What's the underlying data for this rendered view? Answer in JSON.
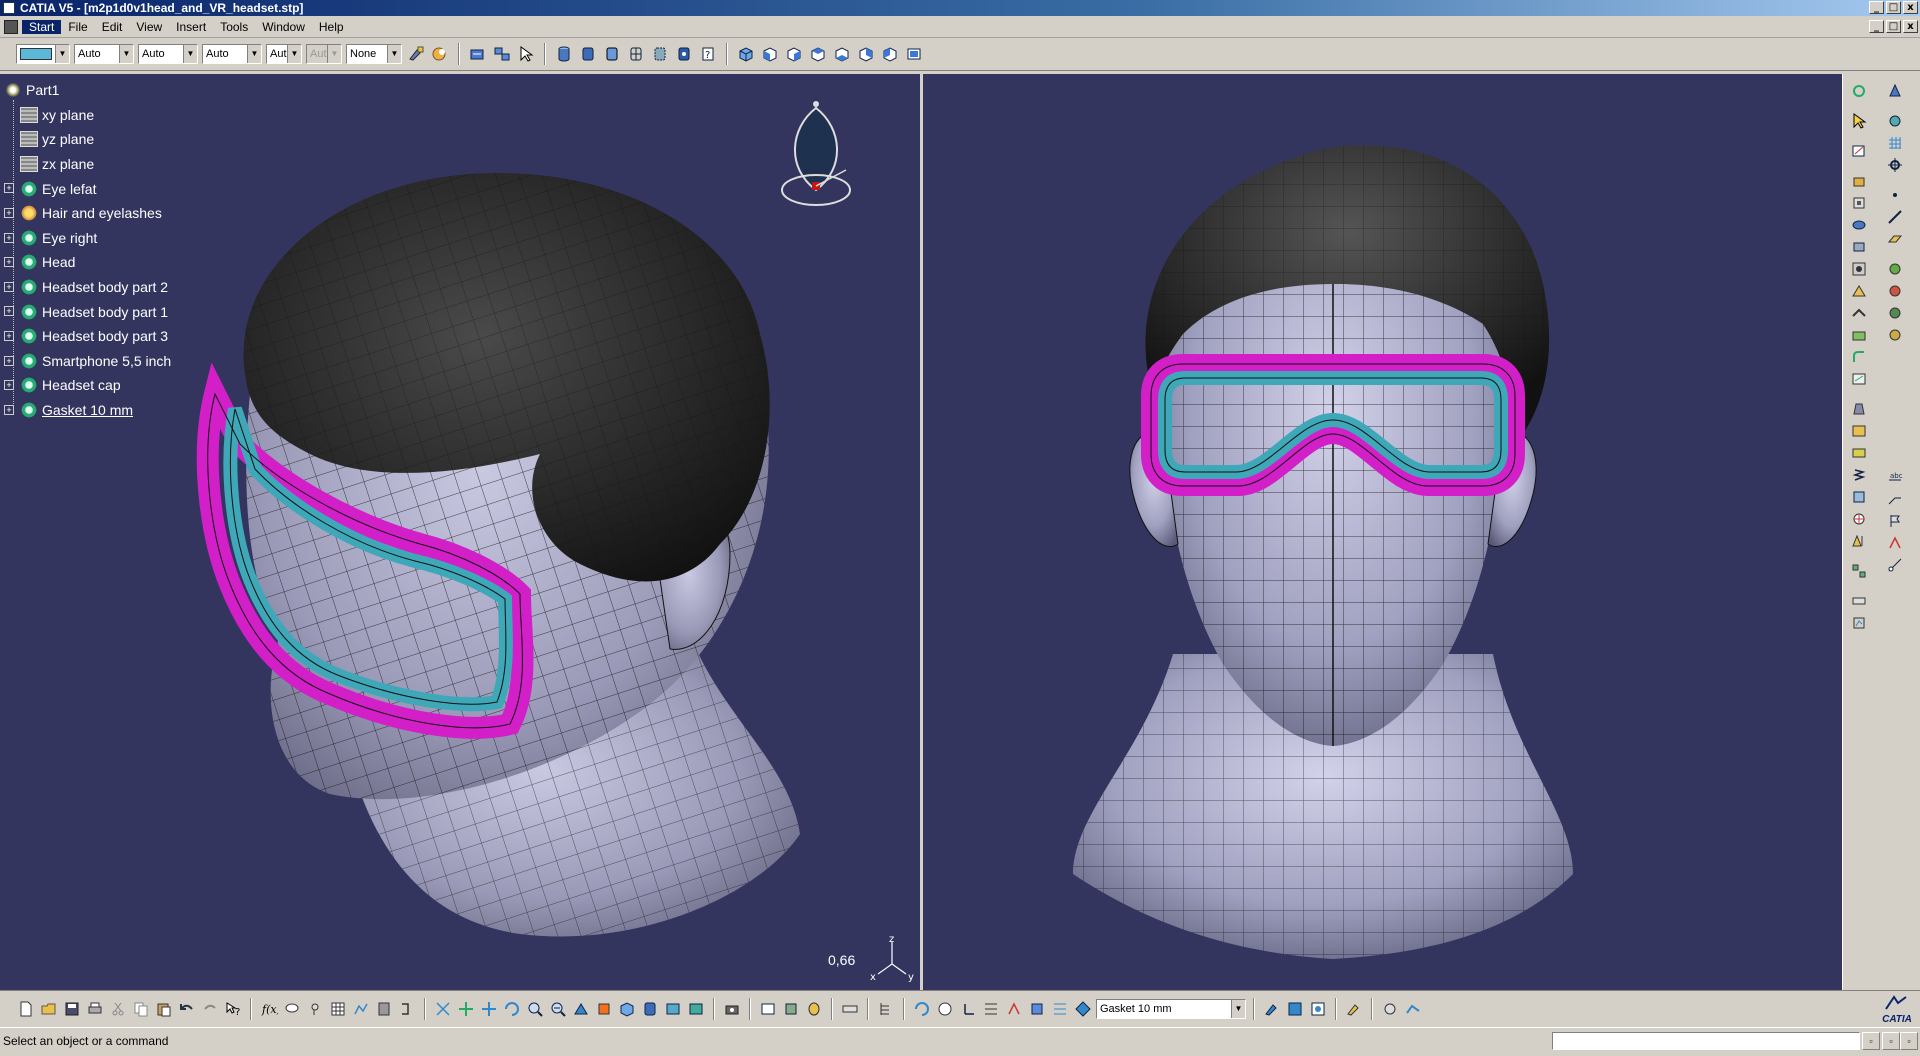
{
  "window": {
    "title": "CATIA V5 - [m2p1d0v1head_and_VR_headset.stp]",
    "controls": [
      "_",
      "□",
      "x"
    ]
  },
  "menu": {
    "items": [
      "Start",
      "File",
      "Edit",
      "View",
      "Insert",
      "Tools",
      "Window",
      "Help"
    ],
    "active": "Start"
  },
  "graphic_properties": {
    "color": "#5bb8d8",
    "transparency": "Auto",
    "line_thickness": "Auto",
    "linetype": "Auto",
    "point_symbol": "Aut",
    "point_symbol_2": "Aut",
    "layer": "None"
  },
  "tree": {
    "root": "Part1",
    "items": [
      {
        "label": "xy plane",
        "type": "plane"
      },
      {
        "label": "yz plane",
        "type": "plane"
      },
      {
        "label": "zx plane",
        "type": "plane"
      },
      {
        "label": "Eye lefat",
        "type": "body"
      },
      {
        "label": "Hair and eyelashes",
        "type": "body-alt"
      },
      {
        "label": "Eye right",
        "type": "body"
      },
      {
        "label": "Head",
        "type": "body"
      },
      {
        "label": "Headset body part 2",
        "type": "body"
      },
      {
        "label": "Headset body part 1",
        "type": "body"
      },
      {
        "label": "Headset body part 3",
        "type": "body"
      },
      {
        "label": "Smartphone 5,5 inch",
        "type": "body"
      },
      {
        "label": "Headset cap",
        "type": "body"
      },
      {
        "label": "Gasket 10 mm",
        "type": "body",
        "selected": true
      }
    ]
  },
  "viewport": {
    "zoom_readout": "0,66",
    "axes": [
      "z",
      "x",
      "y"
    ],
    "background": "#33355f",
    "goggle_colors": {
      "frame": "#d21fc8",
      "gasket": "#3ea8b8"
    }
  },
  "bottom_toolbar": {
    "current_body": "Gasket 10 mm"
  },
  "status": {
    "message": "Select an object or a command",
    "brand": "CATIA"
  }
}
